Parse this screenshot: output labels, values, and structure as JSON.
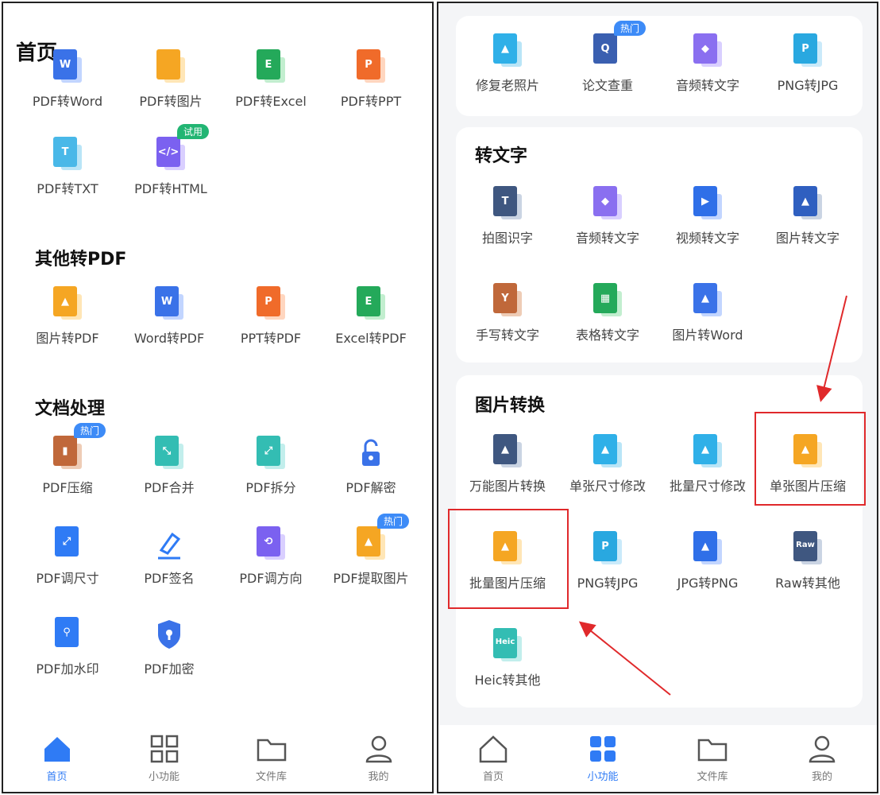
{
  "left_screen": {
    "title": "首页",
    "top_row": [
      "PDF转Word",
      "PDF转图片",
      "PDF转Excel",
      "PDF转PPT"
    ],
    "pdf_other": [
      "PDF转TXT",
      "PDF转HTML"
    ],
    "badge_trial": "试用",
    "section_other_to_pdf": {
      "title": "其他转PDF",
      "items": [
        "图片转PDF",
        "Word转PDF",
        "PPT转PDF",
        "Excel转PDF"
      ]
    },
    "section_doc": {
      "title": "文档处理",
      "items": [
        "PDF压缩",
        "PDF合并",
        "PDF拆分",
        "PDF解密",
        "PDF调尺寸",
        "PDF签名",
        "PDF调方向",
        "PDF提取图片",
        "PDF加水印",
        "PDF加密"
      ]
    },
    "badge_hot": "热门"
  },
  "right_screen": {
    "top_card": [
      "修复老照片",
      "论文查重",
      "音频转文字",
      "PNG转JPG"
    ],
    "badge_hot": "热门",
    "section_text": {
      "title": "转文字",
      "items": [
        "拍图识字",
        "音频转文字",
        "视频转文字",
        "图片转文字",
        "手写转文字",
        "表格转文字",
        "图片转Word"
      ]
    },
    "section_image": {
      "title": "图片转换",
      "items": [
        "万能图片转换",
        "单张尺寸修改",
        "批量尺寸修改",
        "单张图片压缩",
        "批量图片压缩",
        "PNG转JPG",
        "JPG转PNG",
        "Raw转其他",
        "Heic转其他"
      ]
    }
  },
  "tabbar": {
    "tabs": [
      "首页",
      "小功能",
      "文件库",
      "我的"
    ]
  },
  "colors": {
    "accent_blue": "#2f7bf5",
    "highlight_red": "#e0292b",
    "badge_blue": "#3d8bf7",
    "badge_green": "#22b573"
  }
}
